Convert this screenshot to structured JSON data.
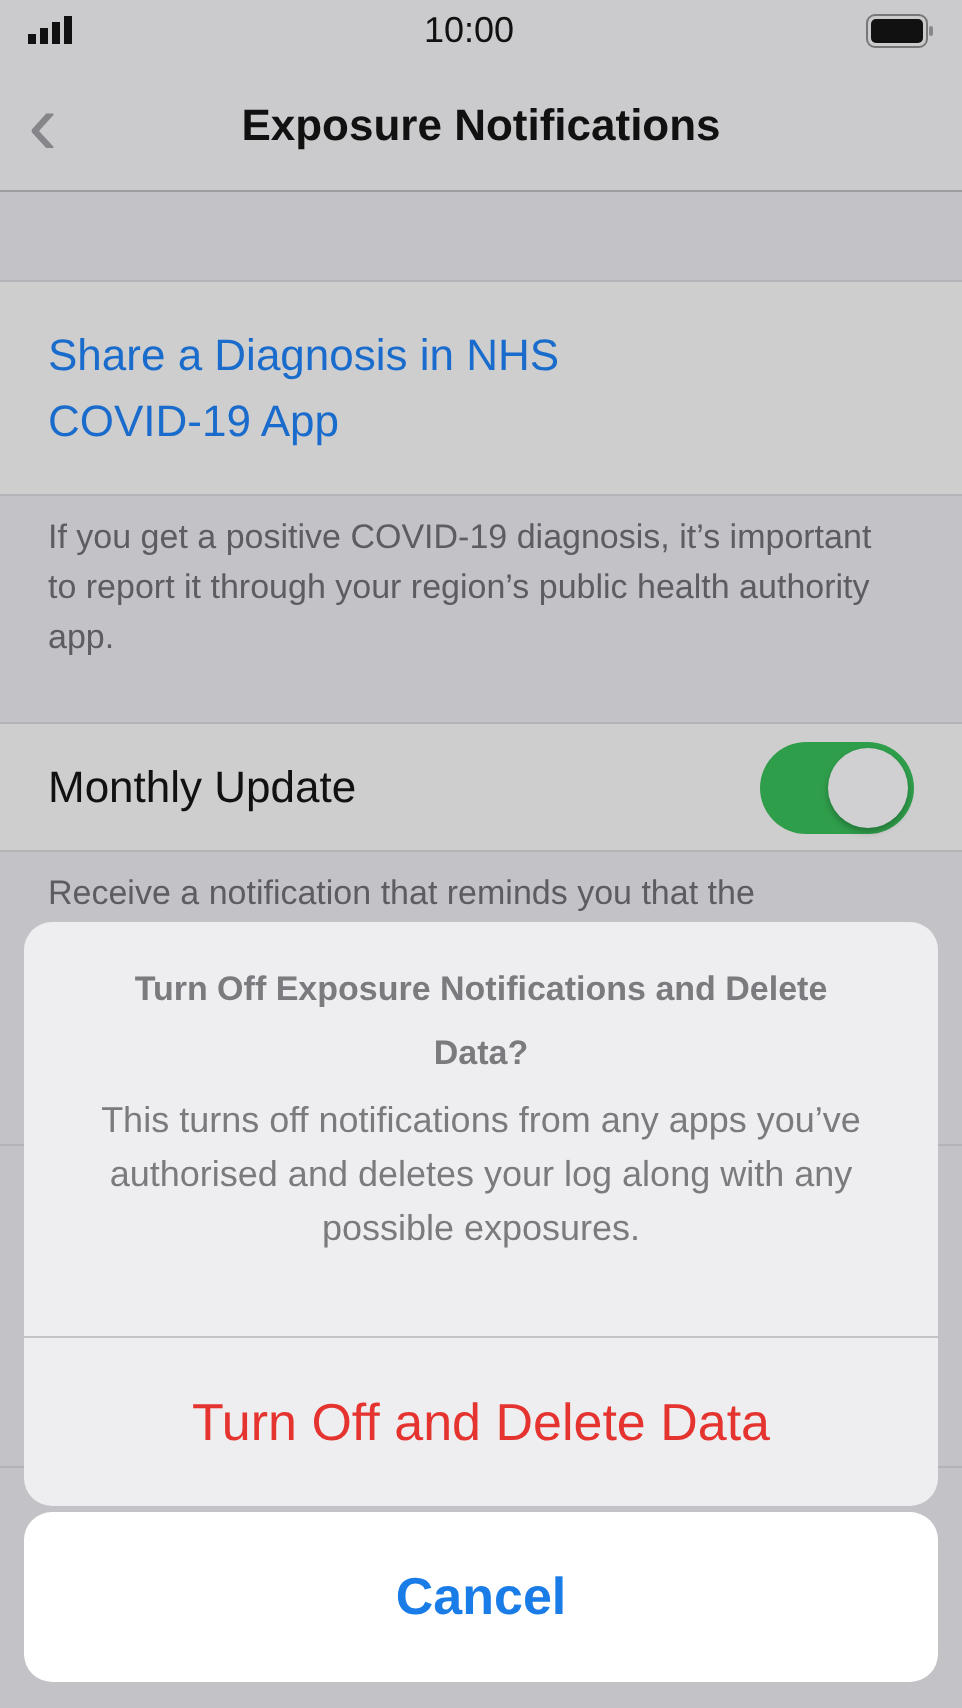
{
  "status_bar": {
    "time": "10:00"
  },
  "nav": {
    "back": "‹",
    "title": "Exposure Notifications"
  },
  "share_cell": {
    "label": "Share a Diagnosis in NHS COVID-19 App"
  },
  "share_footer": "If you get a positive COVID-19 diagnosis, it’s important to report it through your region’s public health authority app.",
  "monthly_update": {
    "label": "Monthly Update",
    "on": true
  },
  "monthly_footer": "Receive a notification that reminds you that the",
  "action_sheet": {
    "title": "Turn Off Exposure Notifications and Delete Data?",
    "message": "This turns off notifications from any apps you’ve authorised and deletes your log along with any possible exposures.",
    "actions": [
      {
        "label": "Turn Off and Delete Data",
        "kind": "destructive"
      }
    ],
    "cancel": "Cancel"
  }
}
